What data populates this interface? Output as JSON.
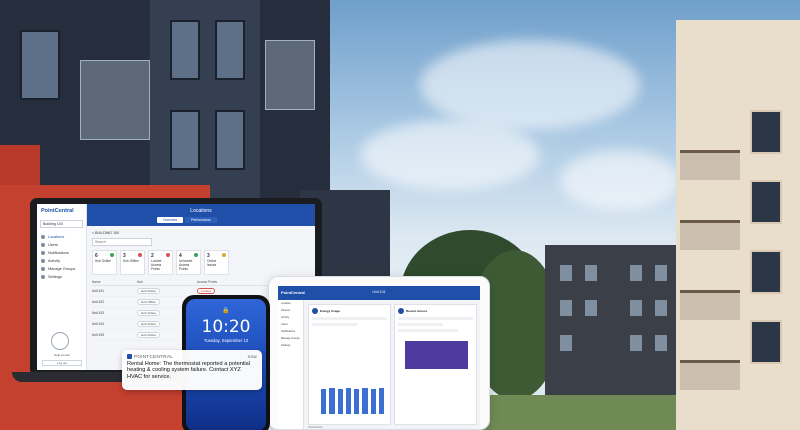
{
  "laptop_app": {
    "logo": "PointCentral",
    "header_title": "Locations",
    "tabs": [
      "Overview",
      "Performance"
    ],
    "building_select": "Building 100",
    "nav": [
      "Locations",
      "Users",
      "Notifications",
      "Activity",
      "Manage Groups",
      "Settings"
    ],
    "breadcrumb": "< BUILDING 100",
    "search_placeholder": "Search",
    "summary_cards": [
      {
        "value": "6",
        "label": "Hub Online"
      },
      {
        "value": "3",
        "label": "Hub Offline"
      },
      {
        "value": "2",
        "label": "Locked Access Points"
      },
      {
        "value": "4",
        "label": "Unlocked Access Points"
      },
      {
        "value": "3",
        "label": "Online Issues"
      }
    ],
    "table_headers": [
      "Name",
      "Hub",
      "Access Points"
    ],
    "rows": [
      {
        "name": "Unit 101",
        "hub": "Hub Online",
        "access": "Locked"
      },
      {
        "name": "Unit 102",
        "hub": "Hub Offline",
        "access": "Unlocked"
      },
      {
        "name": "Unit 103",
        "hub": "Hub Online",
        "access": ""
      },
      {
        "name": "Unit 104",
        "hub": "Hub Online",
        "access": ""
      },
      {
        "name": "Unit 105",
        "hub": "Hub Online",
        "access": ""
      }
    ],
    "help_label": "Help Center",
    "logout_label": "Log out"
  },
  "tablet_app": {
    "logo": "PointCentral",
    "header_title": "Unit 101",
    "nav": [
      "Location",
      "Devices",
      "Activity",
      "Users",
      "Notifications",
      "Manage Groups",
      "Settings"
    ],
    "panel_left_title": "Energy Usage",
    "panel_right_title": "Recent Access",
    "footer_logo": "PointCentral"
  },
  "phone": {
    "time": "10:20",
    "date": "Tuesday, September 13",
    "lock_icon": "lock-icon"
  },
  "notification": {
    "app_name": "POINTCENTRAL",
    "time": "now",
    "message": "Rental Home: The thermostat reported a potential heating & cooling system failure. Contact XYZ HVAC for service."
  },
  "colors": {
    "brand_blue": "#1f4fa8",
    "accent_red": "#c4402f"
  }
}
